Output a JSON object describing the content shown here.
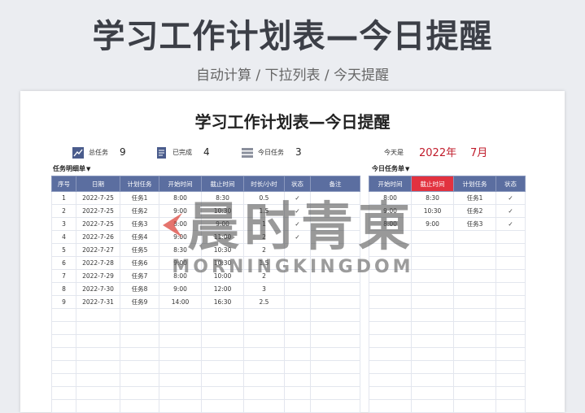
{
  "banner": {
    "title": "学习工作计划表—今日提醒",
    "subtitle": "自动计算 / 下拉列表 / 今天提醒"
  },
  "sheet": {
    "title": "学习工作计划表—今日提醒",
    "stats": [
      {
        "label": "总任务",
        "value": "9",
        "icon": "chart-trend-icon"
      },
      {
        "label": "已完成",
        "value": "4",
        "icon": "document-done-icon"
      },
      {
        "label": "今日任务",
        "value": "3",
        "icon": "list-stack-icon"
      }
    ],
    "today": {
      "label": "今天是",
      "year": "2022年",
      "month": "7月"
    },
    "task_list_label": "任务明细单",
    "today_list_label": "今日任务单",
    "main_table": {
      "headers": [
        "序号",
        "日期",
        "计划任务",
        "开始时间",
        "截止时间",
        "时长/小时",
        "状态",
        "备注"
      ],
      "rows": [
        [
          "1",
          "2022-7-25",
          "任务1",
          "8:00",
          "8:30",
          "0.5",
          "✓",
          ""
        ],
        [
          "2",
          "2022-7-25",
          "任务2",
          "9:00",
          "10:30",
          "1.5",
          "✓",
          ""
        ],
        [
          "3",
          "2022-7-25",
          "任务3",
          "8:00",
          "9:00",
          "1",
          "✓",
          ""
        ],
        [
          "4",
          "2022-7-26",
          "任务4",
          "9:00",
          "11:00",
          "2",
          "✓",
          ""
        ],
        [
          "5",
          "2022-7-27",
          "任务5",
          "8:30",
          "10:30",
          "2",
          "",
          ""
        ],
        [
          "6",
          "2022-7-28",
          "任务6",
          "9:00",
          "10:30",
          "1.5",
          "",
          ""
        ],
        [
          "7",
          "2022-7-29",
          "任务7",
          "8:00",
          "10:00",
          "2",
          "",
          ""
        ],
        [
          "8",
          "2022-7-30",
          "任务8",
          "9:00",
          "12:00",
          "3",
          "",
          ""
        ],
        [
          "9",
          "2022-7-31",
          "任务9",
          "14:00",
          "16:30",
          "2.5",
          "",
          ""
        ]
      ]
    },
    "today_table": {
      "headers": [
        "开始时间",
        "截止时间",
        "计划任务",
        "状态"
      ],
      "rows": [
        [
          "8:00",
          "8:30",
          "任务1",
          "✓"
        ],
        [
          "9:00",
          "10:30",
          "任务2",
          "✓"
        ],
        [
          "8:00",
          "9:00",
          "任务3",
          "✓"
        ]
      ]
    }
  },
  "watermark": {
    "main": "晨时青東",
    "sub": "MORNINGKINGDOM"
  }
}
